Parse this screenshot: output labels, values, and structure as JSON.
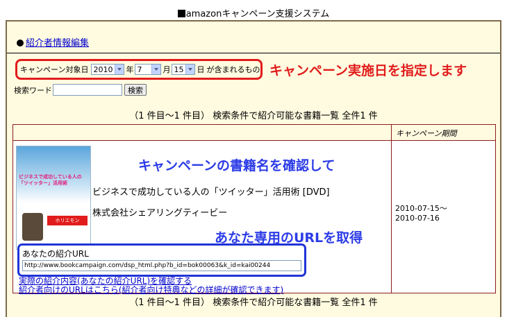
{
  "app": {
    "title_brand": "amazon",
    "title_rest": "キャンペーン支援システム"
  },
  "nav": {
    "edit_introducer_link": "紹介者情報編集"
  },
  "filter": {
    "campaign_date_label": "キャンペーン対象日",
    "year_value": "2010",
    "year_unit": "年",
    "month_value": "7",
    "month_unit": "月",
    "day_value": "15",
    "day_unit": "日",
    "included_suffix": "が含まれるもの",
    "annotation": "キャンペーン実施日を指定します"
  },
  "search": {
    "keyword_label": "検索ワード",
    "keyword_value": "",
    "search_button": "検索"
  },
  "list": {
    "header_summary": "（1 件目～1 件目） 検索条件で紹介可能な書籍一覧 全件1 件",
    "footer_summary": "（1 件目～1 件目） 検索条件で紹介可能な書籍一覧 全件1 件",
    "column_period": "キャンペーン期間"
  },
  "book": {
    "annotation_title": "キャンペーンの書籍名を確認して",
    "title": "ビジネスで成功している人の「ツイッター」活用術 [DVD]",
    "publisher": "株式会社シェアリングティービー",
    "annotation_url": "あなた専用のURLを取得",
    "period_start": "2010-07-15～",
    "period_end": "2010-07-16",
    "cover_text_main": "ビジネスで成功している人の「ツイッター」活用術",
    "cover_text_sub": "ホリエモン",
    "url_label": "あなたの紹介URL",
    "url_value": "http://www.bookcampaign.com/dsp_html.php?b_id=bok00063&k_id=kai00244",
    "link_confirm": "実際の紹介内容(あなたの紹介URL)を確認する",
    "link_introducer": "紹介者向けのURLはこちら(紹介者向け特典などの詳細が確認できます)"
  },
  "colors": {
    "panel_bg": "#fffbe0",
    "red_annotation": "#e11c1c",
    "blue_annotation": "#2b3be6",
    "link": "#0000cc",
    "table_border": "#8b1c1c"
  }
}
